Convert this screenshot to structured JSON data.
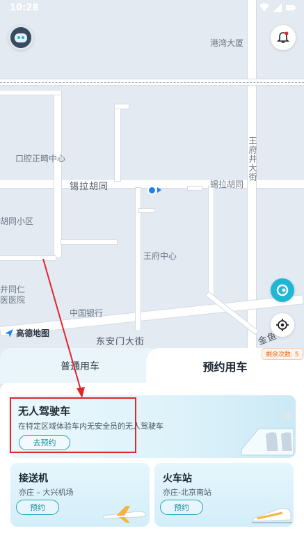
{
  "status": {
    "time": "10:28"
  },
  "map": {
    "labels": {
      "gangwan": "港湾大厦",
      "wangfujing_st": "王府井大街",
      "kouqiang": "口腔正畸中心",
      "xila": "锡拉胡同",
      "xila2": "锡拉胡同",
      "hutong": "胡同小区",
      "wangfu_center": "王府中心",
      "hospital": "井同仁\n医医院",
      "bank": "中国银行",
      "dongan": "东安门大街",
      "jinyu": "金鱼"
    },
    "logo_text": "高德地图",
    "remain_badge": "剩余次数: 5"
  },
  "tabs": {
    "normal": "普通用车",
    "reserve": "预约用车"
  },
  "main_card": {
    "title": "无人驾驶车",
    "desc": "在特定区域体验车内无安全员的无人驾驶车",
    "button": "去预约"
  },
  "pickup_card": {
    "title": "接送机",
    "desc": "亦庄 – 大兴机场",
    "button": "预约"
  },
  "train_card": {
    "title": "火车站",
    "desc": "亦庄-北京南站",
    "button": "预约"
  },
  "colors": {
    "accent": "#1aa6b9",
    "annotation": "#e0262b",
    "user_dot": "#1e7ff0"
  }
}
